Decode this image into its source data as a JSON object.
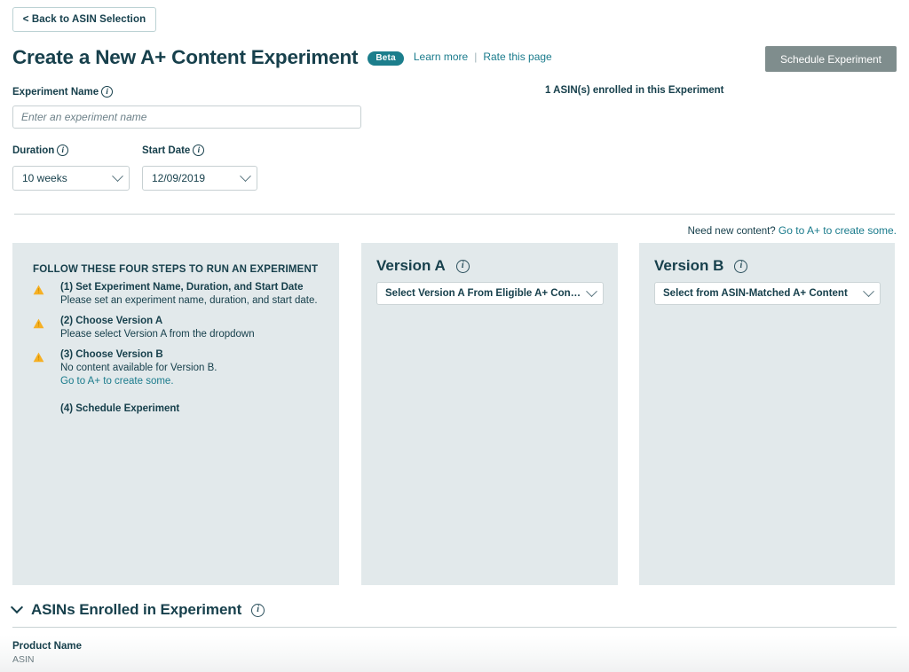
{
  "header": {
    "back_button": "< Back to ASIN Selection",
    "title": "Create a New A+ Content Experiment",
    "beta_badge": "Beta",
    "learn_more": "Learn more",
    "link_separator": "|",
    "rate_this_page": "Rate this page",
    "schedule_button": "Schedule Experiment",
    "enrolled_count": "1 ASIN(s) enrolled in this Experiment"
  },
  "form": {
    "experiment_name_label": "Experiment Name",
    "experiment_name_value": "",
    "experiment_name_placeholder": "Enter an experiment name",
    "duration_label": "Duration",
    "duration_value": "10 weeks",
    "start_date_label": "Start Date",
    "start_date_value": "12/09/2019"
  },
  "need_content": {
    "text": "Need new content?",
    "link": "Go to A+ to create some."
  },
  "steps_panel": {
    "title": "FOLLOW THESE FOUR STEPS TO RUN AN EXPERIMENT",
    "steps": [
      {
        "heading": "(1) Set Experiment Name, Duration, and Start Date",
        "sub": "Please set an experiment name, duration, and start date.",
        "warning": true,
        "link": ""
      },
      {
        "heading": "(2) Choose Version A",
        "sub": "Please select Version A from the dropdown",
        "warning": true,
        "link": ""
      },
      {
        "heading": "(3) Choose Version B",
        "sub": "No content available for Version B.",
        "warning": true,
        "link": "Go to A+ to create some."
      },
      {
        "heading": "(4) Schedule Experiment",
        "sub": "",
        "warning": false,
        "link": ""
      }
    ]
  },
  "version_a": {
    "heading": "Version A",
    "select_value": "Select Version A From Eligible A+ Content"
  },
  "version_b": {
    "heading": "Version B",
    "select_value": "Select from ASIN-Matched A+ Content"
  },
  "asins_section": {
    "title": "ASINs Enrolled in Experiment",
    "column_product_name": "Product Name",
    "column_asin": "ASIN"
  },
  "icons": {
    "info": "i",
    "warning": "warning-triangle",
    "chevron_down": "chevron-down"
  },
  "colors": {
    "teal_link": "#1a7b8c",
    "beta_badge": "#1c7e8c",
    "panel_bg": "#e2e9eb",
    "disabled_button": "#7f8d8d",
    "warning_amber": "#f6b024",
    "text_dark": "#17404c"
  }
}
